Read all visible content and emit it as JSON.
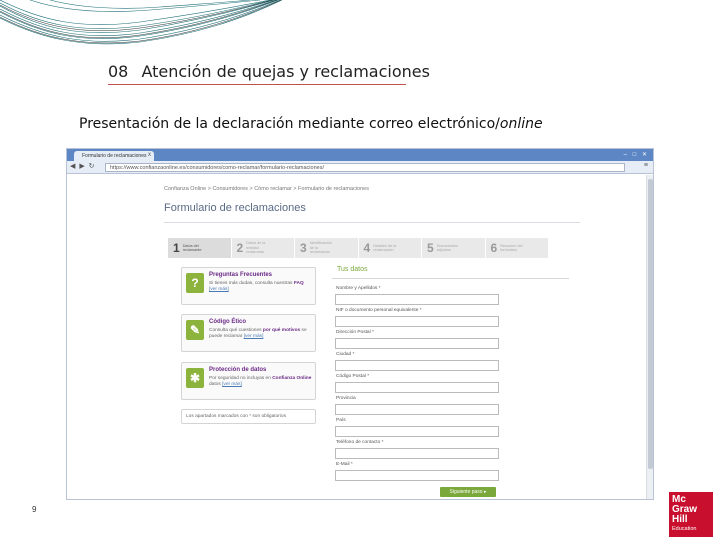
{
  "slide": {
    "chapter_number": "08",
    "chapter_title": "Atención de quejas y reclamaciones",
    "subtitle_main": "Presentación de la declaración mediante correo electrónico/",
    "subtitle_italic": "online",
    "page_number": "9",
    "logo": {
      "line1": "Mc",
      "line2": "Graw",
      "line3": "Hill",
      "line4": "Education"
    }
  },
  "browser": {
    "tab_title": "Formulario de reclamaciones",
    "tab_close": "x",
    "address": "https://www.confianzaonline.es/consumidores/como-reclamar/formulario-reclamaciones/",
    "nav_icons": [
      "back-icon",
      "forward-icon",
      "reload-icon"
    ],
    "menu_icon": "menu-icon"
  },
  "page": {
    "breadcrumbs": "Confianza Online > Consumidores > Cómo reclamar > Formulario de reclamaciones",
    "form_title": "Formulario de reclamaciones",
    "steps": [
      {
        "number": "1",
        "label": "Datos del reclamante"
      },
      {
        "number": "2",
        "label": "Datos de la entidad reclamada"
      },
      {
        "number": "3",
        "label": "Identificación de la reclamación"
      },
      {
        "number": "4",
        "label": "Detalles de la reclamación"
      },
      {
        "number": "5",
        "label": "Documentos adjuntos"
      },
      {
        "number": "6",
        "label": "Resumen del formulario"
      }
    ],
    "side_boxes": [
      {
        "title": "Preguntas Frecuentes",
        "text": "Si tienes más dudas, consulta nuestras",
        "highlight": "FAQ",
        "link": "[ver más]",
        "icon": "question-icon"
      },
      {
        "title": "Código Ético",
        "text": "Consulta qué cuestiones",
        "highlight": "por qué motivos",
        "text2": "se puede reclamar",
        "link": "[ver más]",
        "icon": "pencil-icon"
      },
      {
        "title": "Protección de datos",
        "text": "Por seguridad no incluyas en",
        "highlight": "Confianza Online",
        "text2": "datos",
        "link": "[ver más]",
        "icon": "shield-icon"
      }
    ],
    "legend": "Los apartados marcados con * son obligatorios",
    "section_title": "Tus datos",
    "fields": [
      {
        "label": "Nombre y Apellidos *"
      },
      {
        "label": "NIF o documento personal equivalente *"
      },
      {
        "label": "Dirección Postal *"
      },
      {
        "label": "Ciudad *"
      },
      {
        "label": "Código Postal *"
      },
      {
        "label": "Provincia"
      },
      {
        "label": "País"
      },
      {
        "label": "Teléfono de contacto *"
      },
      {
        "label": "E-Mail *"
      }
    ],
    "next_button": "Siguiente paso",
    "colors": {
      "accent_green": "#7aa83a",
      "purple": "#6b2a85",
      "browser_blue": "#5c86c4",
      "logo_red": "#c8102e"
    }
  }
}
